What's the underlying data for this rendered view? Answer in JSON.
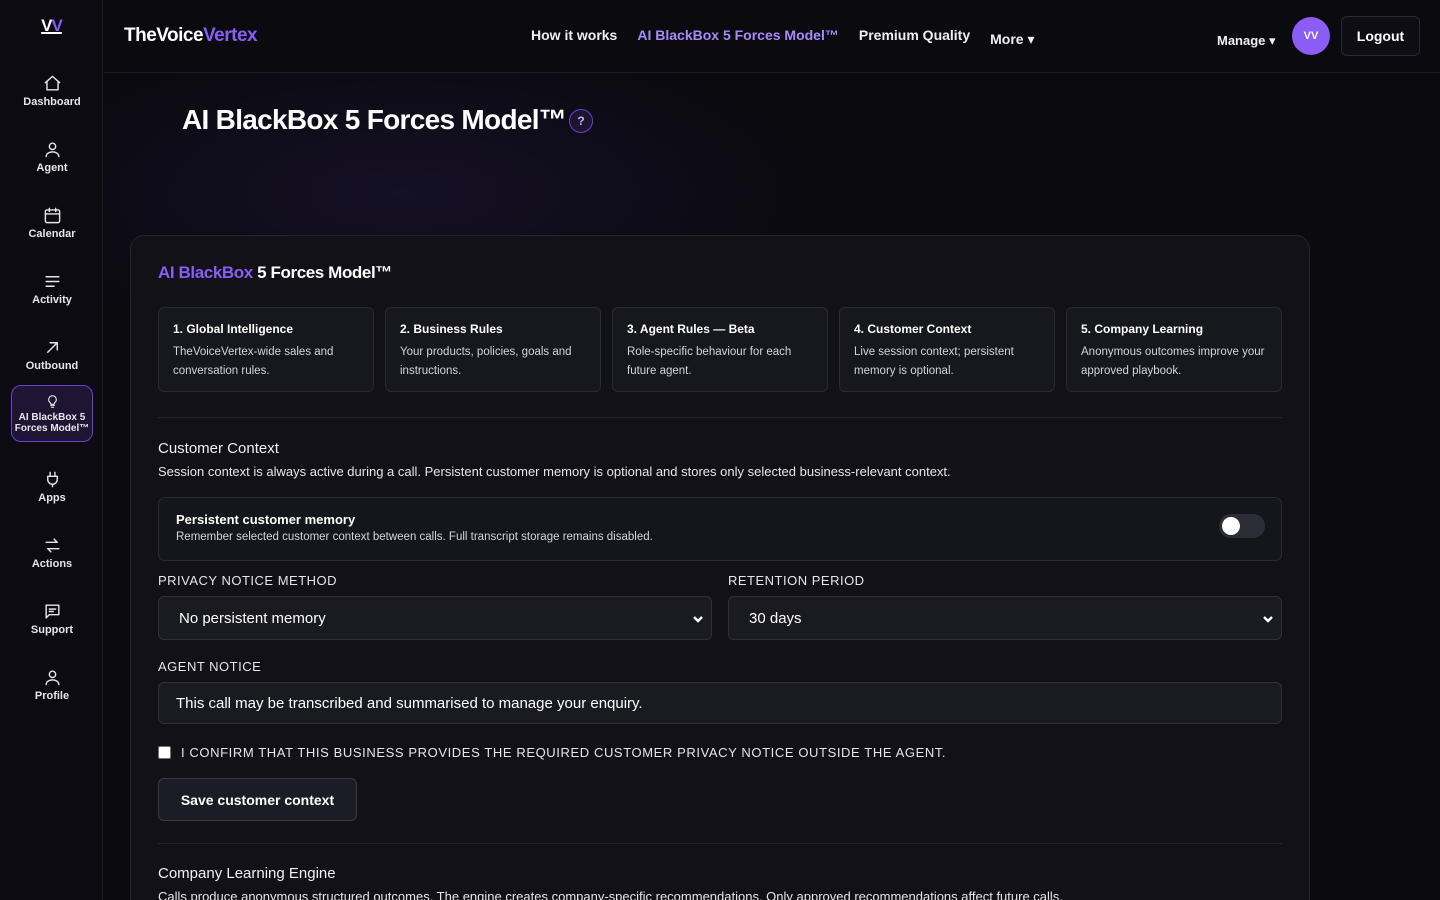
{
  "sidebar": {
    "logo": "VV",
    "items": [
      {
        "label": "Dashboard",
        "icon": "home-icon"
      },
      {
        "label": "Agent",
        "icon": "user-icon"
      },
      {
        "label": "Calendar",
        "icon": "calendar-icon"
      },
      {
        "label": "Activity",
        "icon": "list-icon"
      },
      {
        "label": "Outbound",
        "icon": "arrow-up-right-icon"
      },
      {
        "label": "AI BlackBox 5 Forces Model™",
        "icon": "lightbulb-icon"
      },
      {
        "label": "Apps",
        "icon": "plug-icon"
      },
      {
        "label": "Actions",
        "icon": "swap-arrows-icon"
      },
      {
        "label": "Support",
        "icon": "chat-icon"
      },
      {
        "label": "Profile",
        "icon": "user-icon"
      }
    ]
  },
  "header": {
    "brand_main": "TheVoice",
    "brand_accent": "Vertex",
    "nav": [
      "How it works",
      "AI BlackBox 5 Forces Model™",
      "Premium Quality",
      "More ▾"
    ],
    "manage": "Manage ▾",
    "avatar": "VV",
    "logout": "Logout"
  },
  "page": {
    "title": "AI BlackBox 5 Forces Model™",
    "help": "?"
  },
  "card": {
    "title_accent": "AI BlackBox",
    "title_rest": " 5 Forces Model™",
    "forces": [
      {
        "title": "1. Global Intelligence",
        "desc": "TheVoiceVertex-wide sales and conversation rules."
      },
      {
        "title": "2. Business Rules",
        "desc": "Your products, policies, goals and instructions."
      },
      {
        "title": "3. Agent Rules — Beta",
        "desc": "Role-specific behaviour for each future agent."
      },
      {
        "title": "4. Customer Context",
        "desc": "Live session context; persistent memory is optional."
      },
      {
        "title": "5. Company Learning",
        "desc": "Anonymous outcomes improve your approved playbook."
      }
    ],
    "customer_context": {
      "title": "Customer Context",
      "desc": "Session context is always active during a call. Persistent customer memory is optional and stores only selected business-relevant context.",
      "memory_title": "Persistent customer memory",
      "memory_desc": "Remember selected customer context between calls. Full transcript storage remains disabled.",
      "memory_enabled": false,
      "privacy_label": "PRIVACY NOTICE METHOD",
      "privacy_value": "No persistent memory",
      "retention_label": "RETENTION PERIOD",
      "retention_value": "30 days",
      "notice_label": "AGENT NOTICE",
      "notice_value": "This call may be transcribed and summarised to manage your enquiry.",
      "confirm_label": "I CONFIRM THAT THIS BUSINESS PROVIDES THE REQUIRED CUSTOMER PRIVACY NOTICE OUTSIDE THE AGENT.",
      "save_label": "Save customer context"
    },
    "learning": {
      "title": "Company Learning Engine",
      "desc": "Calls produce anonymous structured outcomes. The engine creates company-specific recommendations. Only approved recommendations affect future calls."
    }
  },
  "colors": {
    "accent": "#8b5cf6",
    "accent_light": "#a78bfa",
    "background": "#0a0a0f",
    "card": "#111117"
  }
}
